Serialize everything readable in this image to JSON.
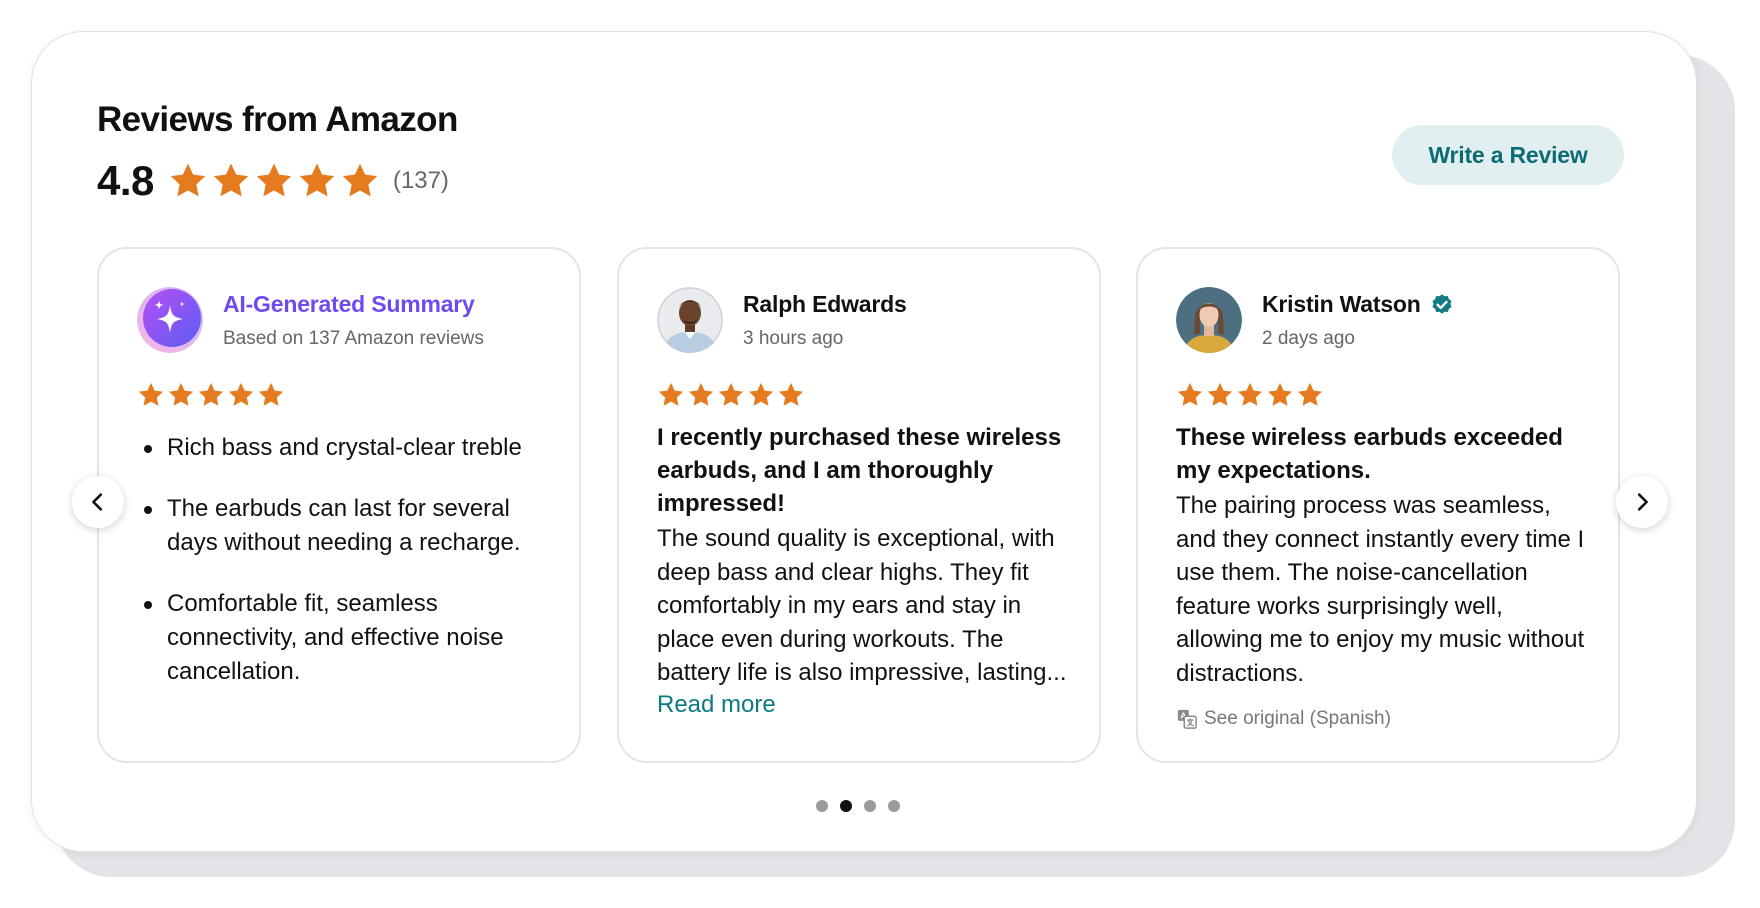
{
  "header": {
    "title": "Reviews from Amazon",
    "rating": "4.8",
    "star_count": 5,
    "review_count": "(137)",
    "write_review_label": "Write a Review"
  },
  "colors": {
    "star": "#e57a1f",
    "accent_teal": "#0d6b73",
    "ai_gradient_start": "#a855f7",
    "ai_gradient_end": "#3b82f6"
  },
  "cards": [
    {
      "type": "ai-summary",
      "icon": "sparkles-icon",
      "title": "AI-Generated Summary",
      "subtitle": "Based on 137 Amazon reviews",
      "stars": 5,
      "points": [
        "Rich bass and crystal-clear treble",
        "The earbuds can last for several days without needing a recharge.",
        "Comfortable fit, seamless connectivity, and effective noise cancellation."
      ]
    },
    {
      "type": "review",
      "author": "Ralph Edwards",
      "time": "3 hours ago",
      "stars": 5,
      "headline": "I recently purchased these wireless earbuds, and I am thoroughly impressed!",
      "text": "The sound quality is exceptional, with deep bass and clear highs. They fit comfortably in my ears and stay in place even during workouts. The battery life is also impressive, lasting...",
      "read_more": "Read more"
    },
    {
      "type": "review",
      "author": "Kristin Watson",
      "verified": true,
      "time": "2 days ago",
      "stars": 5,
      "headline": "These wireless earbuds exceeded my expectations.",
      "text": "The pairing process was seamless, and they connect instantly every time I use them. The noise-cancellation feature works surprisingly well, allowing me to enjoy my music without distractions.",
      "see_original": "See original (Spanish)"
    }
  ],
  "pagination": {
    "pages": 4,
    "active": 2
  }
}
